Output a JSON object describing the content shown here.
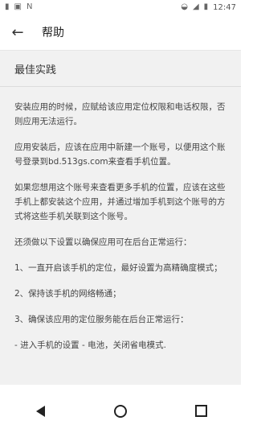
{
  "status": {
    "time": "12:47",
    "left_icons": [
      "sim-icon",
      "image-icon",
      "n-icon"
    ],
    "right_icons": [
      "wifi-icon",
      "signal-icon",
      "battery-icon"
    ]
  },
  "toolbar": {
    "back_icon": "arrow-left",
    "title": "帮助"
  },
  "section": {
    "title": "最佳实践"
  },
  "paragraphs": [
    "安装应用的时候，应赋给该应用定位权限和电话权限，否则应用无法运行。",
    "应用安装后，应该在应用中新建一个账号，以便用这个账号登录到bd.513gs.com来查看手机位置。",
    "如果您想用这个账号来查看更多手机的位置，应该在这些手机上都安装这个应用，并通过增加手机到这个账号的方式将这些手机关联到这个账号。",
    "还须做以下设置以确保应用可在后台正常运行：",
    "1、一直开启该手机的定位，最好设置为高精确度模式；",
    "2、保持该手机的网络畅通；",
    "3、确保该应用的定位服务能在后台正常运行：",
    "- 进入手机的设置 - 电池，关闭省电模式."
  ],
  "nav": {
    "back": "back-icon",
    "home": "home-icon",
    "recents": "recents-icon"
  }
}
